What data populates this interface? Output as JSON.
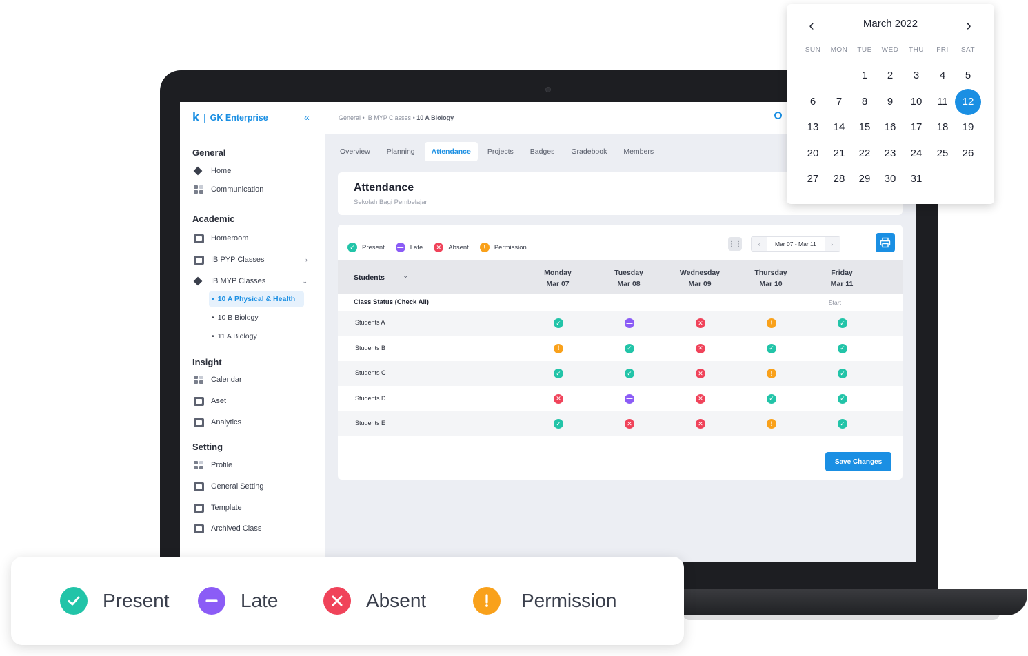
{
  "brand": {
    "logo": "k",
    "name": "GK Enterprise"
  },
  "breadcrumb": {
    "part1": "General",
    "part2": "IB MYP Classes",
    "current": "10 A Biology"
  },
  "sidebar": {
    "general": {
      "title": "General",
      "items": [
        "Home",
        "Communication"
      ]
    },
    "academic": {
      "title": "Academic",
      "items": [
        "Homeroom",
        "IB PYP Classes",
        "IB MYP Classes"
      ],
      "sub_items": [
        "10 A Physical & Health",
        "10 B Biology",
        "11 A Biology"
      ]
    },
    "insight": {
      "title": "Insight",
      "items": [
        "Calendar",
        "Aset",
        "Analytics"
      ]
    },
    "setting": {
      "title": "Setting",
      "items": [
        "Profile",
        "General Setting",
        "Template",
        "Archived Class"
      ]
    }
  },
  "tabs": [
    "Overview",
    "Planning",
    "Attendance",
    "Projects",
    "Badges",
    "Gradebook",
    "Members"
  ],
  "active_tab": "Attendance",
  "header": {
    "title": "Attendance",
    "subtitle": "Sekolah Bagi Pembelajar"
  },
  "legend": {
    "present": "Present",
    "late": "Late",
    "absent": "Absent",
    "permission": "Permission"
  },
  "date_range": "Mar 07 - Mar 11",
  "table": {
    "students_header": "Students",
    "days": [
      {
        "day": "Monday",
        "date": "Mar 07"
      },
      {
        "day": "Tuesday",
        "date": "Mar 08"
      },
      {
        "day": "Wednesday",
        "date": "Mar 09"
      },
      {
        "day": "Thursday",
        "date": "Mar 10"
      },
      {
        "day": "Friday",
        "date": "Mar 11"
      }
    ],
    "status_label": "Class Status (Check All)",
    "status_start": "Start",
    "rows": [
      {
        "name": "Students A",
        "status": [
          "present",
          "late",
          "absent",
          "permission",
          "present"
        ]
      },
      {
        "name": "Students B",
        "status": [
          "permission",
          "present",
          "absent",
          "present",
          "present"
        ]
      },
      {
        "name": "Students C",
        "status": [
          "present",
          "present",
          "absent",
          "permission",
          "present"
        ]
      },
      {
        "name": "Students D",
        "status": [
          "absent",
          "late",
          "absent",
          "present",
          "present"
        ]
      },
      {
        "name": "Students E",
        "status": [
          "present",
          "absent",
          "absent",
          "permission",
          "present"
        ]
      }
    ]
  },
  "save_label": "Save Changes",
  "calendar": {
    "title": "March 2022",
    "weekdays": [
      "SUN",
      "MON",
      "TUE",
      "WED",
      "THU",
      "FRI",
      "SAT"
    ],
    "first_weekday_index": 2,
    "days_in_month": 31,
    "selected": 12
  },
  "colors": {
    "accent": "#1a8fe3",
    "present": "#22c4a8",
    "late": "#8b5cf6",
    "absent": "#f0435a",
    "permission": "#f9a11b"
  },
  "icons": {
    "present": "check-circle-icon",
    "late": "minus-circle-icon",
    "absent": "x-circle-icon",
    "permission": "exclamation-circle-icon"
  }
}
